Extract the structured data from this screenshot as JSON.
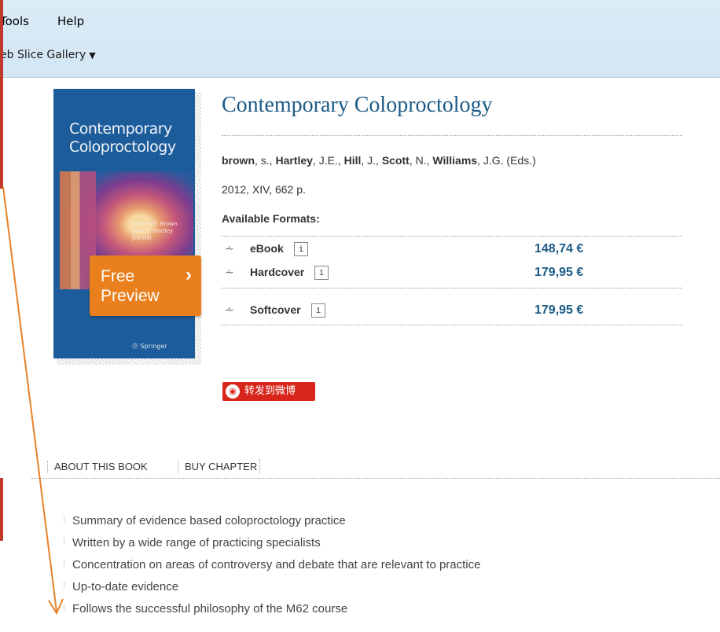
{
  "menu": {
    "tools": "Tools",
    "help": "Help"
  },
  "favorites": {
    "web_slice_gallery": "eb Slice Gallery",
    "caret": "▼"
  },
  "book": {
    "cover_title": "Contemporary Coloproctology",
    "cover_authors": [
      "Steven R. Brown",
      "John E. Hartley",
      "Jim Hill"
    ],
    "cover_publisher": "Springer",
    "free_preview_label": "Free Preview",
    "free_preview_arrow": "›",
    "title": "Contemporary Coloproctology",
    "editors": [
      {
        "name": "brown",
        "suffix": ", s., "
      },
      {
        "name": "Hartley",
        "suffix": ", J.E., "
      },
      {
        "name": "Hill",
        "suffix": ", J., "
      },
      {
        "name": "Scott",
        "suffix": ", N., "
      },
      {
        "name": "Williams",
        "suffix": ", J.G. (Eds.)"
      }
    ],
    "year_pages": "2012, XIV, 662 p.",
    "available_formats_label": "Available Formats:",
    "formats": [
      {
        "icon": "expand-icon",
        "name": "eBook",
        "info": "i",
        "price": "148,74 €"
      },
      {
        "icon": "expand-icon",
        "name": "Hardcover",
        "info": "i",
        "price": "179,95 €"
      },
      {
        "icon": "expand-icon",
        "name": "Softcover",
        "info": "i",
        "price": "179,95 €"
      }
    ]
  },
  "share": {
    "weibo_label": "转发到微博"
  },
  "tabs": [
    "ABOUT THIS BOOK",
    "BUY CHAPTER"
  ],
  "bullets": [
    "Summary of evidence based coloproctology practice",
    "Written by a wide range of practicing specialists",
    "Concentration on areas of controversy and debate that are relevant to practice",
    "Up-to-date evidence",
    "Follows the successful philosophy of the M62 course"
  ],
  "colors": {
    "accent": "#1b5a86",
    "free_preview": "#e97f1d",
    "weibo": "#d9261c",
    "annotation_arrow": "#e8812a"
  }
}
